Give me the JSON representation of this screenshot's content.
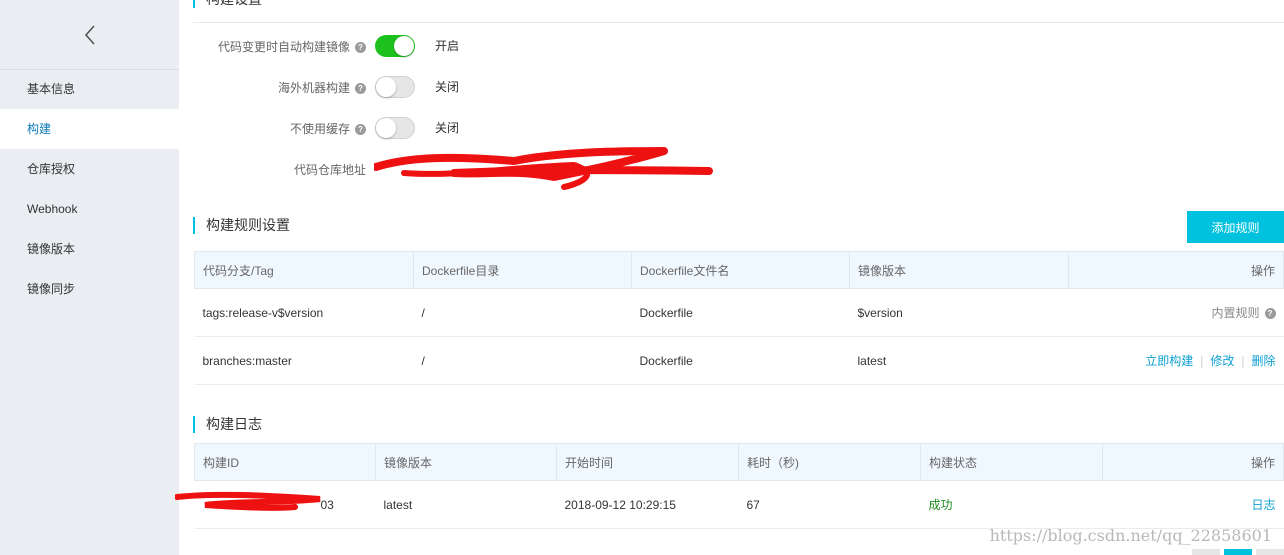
{
  "sidebar": {
    "items": [
      {
        "label": "基本信息"
      },
      {
        "label": "构建"
      },
      {
        "label": "仓库授权"
      },
      {
        "label": "Webhook"
      },
      {
        "label": "镜像版本"
      },
      {
        "label": "镜像同步"
      }
    ],
    "active_index": 1
  },
  "build_settings": {
    "title": "构建设置",
    "rows": [
      {
        "label": "代码变更时自动构建镜像",
        "state_label": "开启",
        "on": true
      },
      {
        "label": "海外机器构建",
        "state_label": "关闭",
        "on": false
      },
      {
        "label": "不使用缓存",
        "state_label": "关闭",
        "on": false
      }
    ],
    "repo_label": "代码仓库地址"
  },
  "build_rules": {
    "title": "构建规则设置",
    "add_button": "添加规则",
    "columns": [
      "代码分支/Tag",
      "Dockerfile目录",
      "Dockerfile文件名",
      "镜像版本",
      "操作"
    ],
    "rows": [
      {
        "branch": "tags:release-v$version",
        "dir": "/",
        "file": "Dockerfile",
        "version": "$version",
        "builtin": "内置规则"
      },
      {
        "branch": "branches:master",
        "dir": "/",
        "file": "Dockerfile",
        "version": "latest",
        "actions": [
          "立即构建",
          "修改",
          "删除"
        ]
      }
    ]
  },
  "build_log": {
    "title": "构建日志",
    "columns": [
      "构建ID",
      "镜像版本",
      "开始时间",
      "耗时（秒)",
      "构建状态",
      "操作"
    ],
    "rows": [
      {
        "id_suffix": "03",
        "version": "latest",
        "start": "2018-09-12 10:29:15",
        "duration": "67",
        "status": "成功",
        "action": "日志"
      }
    ]
  },
  "watermark": "https://blog.csdn.net/qq_22858601",
  "colors": {
    "accent": "#00c1de",
    "toggle_on": "#1dc11d",
    "link": "#0ea0d2",
    "success": "#1e8c1e",
    "redaction": "#ee1111"
  }
}
